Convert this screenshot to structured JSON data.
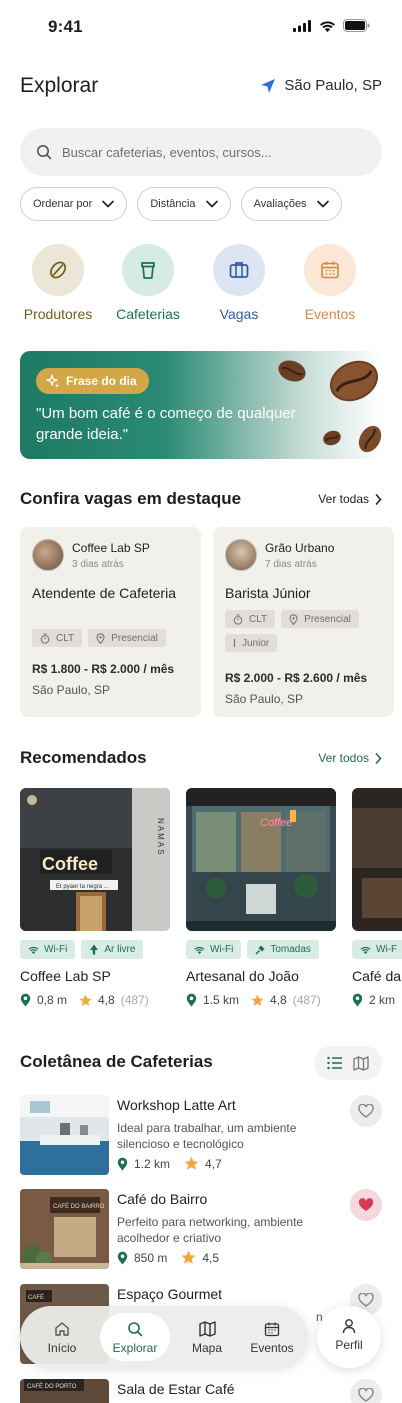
{
  "status_bar": {
    "time": "9:41"
  },
  "header": {
    "title": "Explorar",
    "location": "São Paulo, SP"
  },
  "search": {
    "placeholder": "Buscar cafeterias, eventos, cursos..."
  },
  "filters": [
    {
      "label": "Ordenar por"
    },
    {
      "label": "Distância"
    },
    {
      "label": "Avaliações"
    }
  ],
  "categories": [
    {
      "label": "Produtores",
      "icon": "coffee-bean-icon",
      "color": "#6e5f1c",
      "bg": "#ece6d6"
    },
    {
      "label": "Cafeterias",
      "icon": "coffee-cup-icon",
      "color": "#1d6e55",
      "bg": "#d5ebe3"
    },
    {
      "label": "Vagas",
      "icon": "briefcase-icon",
      "color": "#2f5b9a",
      "bg": "#dde4f4"
    },
    {
      "label": "Eventos",
      "icon": "calendar-icon",
      "color": "#d28a4a",
      "bg": "#fbe7d6"
    }
  ],
  "banner": {
    "badge": "Frase do dia",
    "quote": "\"Um bom café é o começo de qualquer grande ideia.\""
  },
  "jobs_section": {
    "title": "Confira vagas em destaque",
    "see_all": "Ver todas"
  },
  "jobs": [
    {
      "company": "Coffee Lab SP",
      "date": "3 dias atrás",
      "title": "Atendente de Cafeteria",
      "tags": [
        "CLT",
        "Presencial"
      ],
      "salary": "R$ 1.800 - R$ 2.000 / mês",
      "location": "São Paulo, SP"
    },
    {
      "company": "Grão Urbano",
      "date": "7 dias atrás",
      "title": "Barista Júnior",
      "tags": [
        "CLT",
        "Presencial",
        "Junior"
      ],
      "salary": "R$ 2.000 - R$ 2.600 / mês",
      "location": "São Paulo, SP"
    }
  ],
  "recommended_section": {
    "title": "Recomendados",
    "see_all": "Ver todos"
  },
  "recommended": [
    {
      "name": "Coffee Lab SP",
      "tags": [
        "Wi-Fi",
        "Ar livre"
      ],
      "distance": "0,8 m",
      "rating": "4,8",
      "reviews": "(487)",
      "sign": "Coffee",
      "side_sign": "NAMAS",
      "door": "Et pyaer ta negra ..."
    },
    {
      "name": "Artesanal do João",
      "tags": [
        "Wi-Fi",
        "Tomadas"
      ],
      "distance": "1.5 km",
      "rating": "4,8",
      "reviews": "(487)",
      "neon": "Coffee"
    },
    {
      "name": "Café da",
      "tags": [
        "Wi-F"
      ],
      "distance": "2 km",
      "rating": "",
      "reviews": ""
    }
  ],
  "collection_section": {
    "title": "Coletânea de Cafeterias"
  },
  "collection": [
    {
      "name": "Workshop Latte Art",
      "desc": "Ideal para trabalhar, um ambiente silencioso e tecnológico",
      "distance": "1.2 km",
      "rating": "4,7",
      "favorite": false
    },
    {
      "name": "Café do Bairro",
      "desc": "Perfeito para networking, ambiente acolhedor e criativo",
      "distance": "850 m",
      "rating": "4,5",
      "favorite": true,
      "sign": "CAFÉ DO BAIRRO"
    },
    {
      "name": "Espaço Gourmet",
      "desc": "n pr",
      "favorite": false,
      "sign": "CAFÉ"
    },
    {
      "name": "Sala de Estar Café",
      "favorite": false,
      "sign": "CAFÉ DO PORTO"
    }
  ],
  "bottom_nav": [
    {
      "label": "Início",
      "icon": "home-icon"
    },
    {
      "label": "Explorar",
      "icon": "search-icon",
      "active": true
    },
    {
      "label": "Mapa",
      "icon": "map-icon"
    },
    {
      "label": "Eventos",
      "icon": "calendar-icon"
    }
  ],
  "profile": {
    "label": "Perfil",
    "icon": "user-icon"
  },
  "colors": {
    "brand_green": "#1d6e55",
    "star": "#f2a93b",
    "heart": "#d33b55"
  }
}
